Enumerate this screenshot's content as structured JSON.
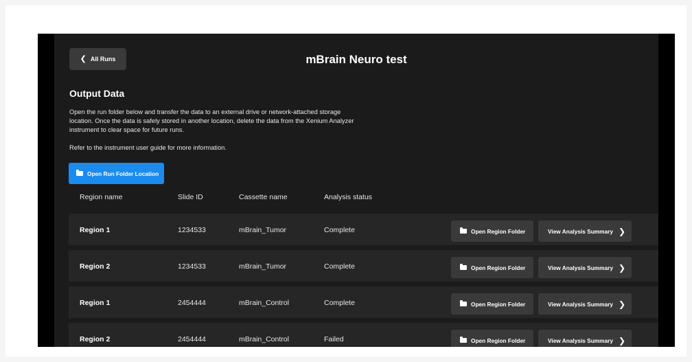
{
  "header": {
    "back_label": "All Runs",
    "title": "mBrain Neuro test"
  },
  "output": {
    "section_title": "Output Data",
    "description": "Open the run folder below and transfer the data to an external drive or network-attached storage location. Once the data is safely stored in another location, delete the data from the Xenium Analyzer instrument to clear space for future runs.",
    "note": "Refer to the instrument user guide for more information.",
    "open_run_folder_label": "Open Run Folder Location"
  },
  "table": {
    "columns": [
      "Region name",
      "Slide ID",
      "Cassette name",
      "Analysis status"
    ],
    "open_region_label": "Open Region Folder",
    "view_summary_label": "View Analysis Summary",
    "rows": [
      {
        "region": "Region 1",
        "slide_id": "1234533",
        "cassette": "mBrain_Tumor",
        "status": "Complete"
      },
      {
        "region": "Region 2",
        "slide_id": "1234533",
        "cassette": "mBrain_Tumor",
        "status": "Complete"
      },
      {
        "region": "Region 1",
        "slide_id": "2454444",
        "cassette": "mBrain_Control",
        "status": "Complete"
      },
      {
        "region": "Region 2",
        "slide_id": "2454444",
        "cassette": "mBrain_Control",
        "status": "Failed"
      }
    ]
  },
  "icons": {
    "back": "chevron-left-icon",
    "folder": "folder-icon",
    "forward": "chevron-right-icon"
  },
  "colors": {
    "panel_bg": "#1b1b1b",
    "row_bg": "#262626",
    "button_bg": "#3a3a3a",
    "primary": "#1a8cf0"
  }
}
